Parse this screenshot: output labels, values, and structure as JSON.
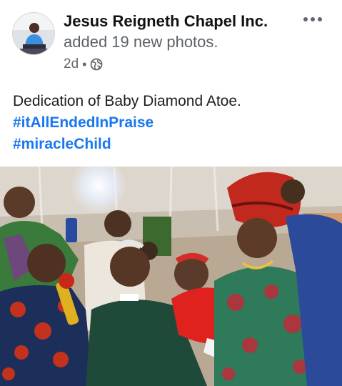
{
  "post": {
    "page_name": "Jesus Reigneth Chapel Inc.",
    "action": "added 19 new photos.",
    "time": "2d",
    "separator": "•",
    "privacy_icon": "globe-icon",
    "more_icon": "more-dots-icon",
    "caption": "Dedication of Baby Diamond Atoe.",
    "hashtags": [
      "#itAllEndedInPraise",
      "#miracleChild"
    ]
  },
  "colors": {
    "hashtag": "#1877f2",
    "secondary_text": "#65676b"
  }
}
